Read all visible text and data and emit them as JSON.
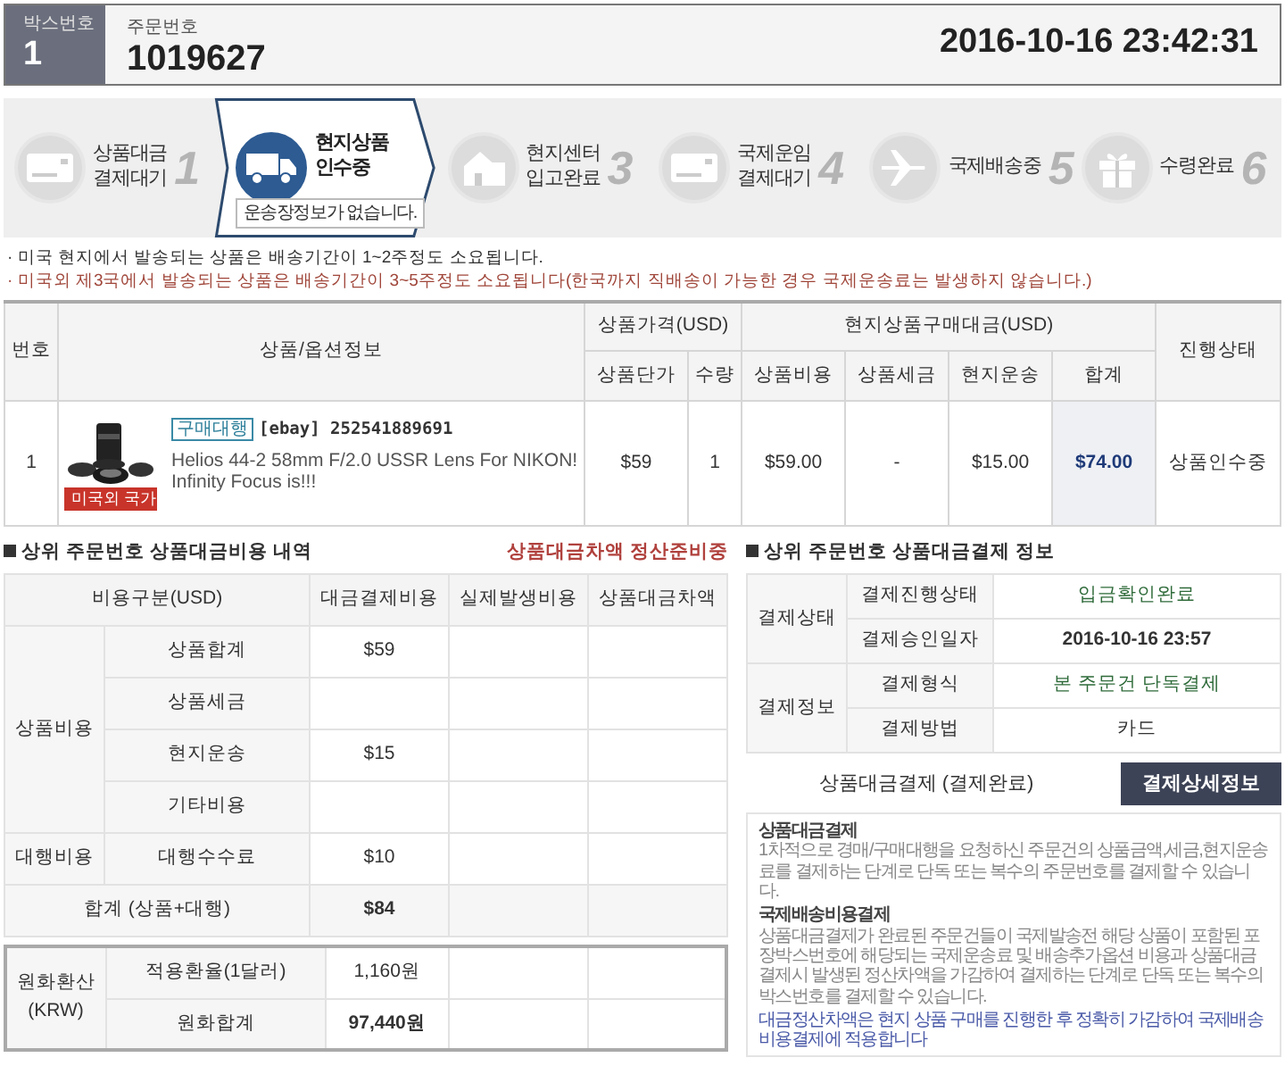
{
  "header": {
    "box_label": "박스번호",
    "box_number": "1",
    "order_label": "주문번호",
    "order_number": "1019627",
    "datetime": "2016-10-16 23:42:31"
  },
  "steps": [
    {
      "number": "1",
      "label": [
        "상품대금",
        "결제대기"
      ],
      "selected": false
    },
    {
      "label": [
        "현지상품",
        "인수중"
      ],
      "selected": true,
      "note": "운송장정보가 없습니다."
    },
    {
      "number": "3",
      "label": [
        "현지센터",
        "입고완료"
      ],
      "selected": false
    },
    {
      "number": "4",
      "label": [
        "국제운임",
        "결제대기"
      ],
      "selected": false
    },
    {
      "number": "5",
      "label": [
        "국제배송중"
      ],
      "selected": false
    },
    {
      "number": "6",
      "label": [
        "수령완료"
      ],
      "selected": false
    }
  ],
  "notices": [
    {
      "text": "· 미국 현지에서 발송되는 상품은 배송기간이 1~2주정도 소요됩니다.",
      "kind": "info"
    },
    {
      "text": "· 미국외 제3국에서 발송되는 상품은 배송기간이 3~5주정도 소요됩니다(한국까지 직배송이 가능한 경우 국제운송료는 발생하지 않습니다.)",
      "kind": "warning"
    }
  ],
  "order_table": {
    "columns": [
      "번호",
      "상품/옵션정보",
      "상품가격(USD)",
      "현지상품구매대금(USD)",
      "진행상태"
    ],
    "subcolumns": [
      "상품단가",
      "수량",
      "상품비용",
      "상품세금",
      "현지운송",
      "합계"
    ],
    "rows": [
      {
        "no": "1",
        "badge": "구매대행",
        "site_and_id": "[ebay] 252541889691",
        "name": "Helios 44-2 58mm F/2.0 USSR Lens For NIKON! Infinity Focus is!!!",
        "origin_tag": "미국외 국가",
        "unit_price": "$59",
        "qty": "1",
        "cost": "$59.00",
        "tax": "-",
        "shipping": "$15.00",
        "total": "$74.00",
        "status": "상품인수중"
      }
    ]
  },
  "cost_table": {
    "title": "상위 주문번호 상품대금비용 내역",
    "status": "상품대금차액 정산준비중",
    "columns": [
      "비용구분(USD)",
      "대금결제비용",
      "실제발생비용",
      "상품대금차액"
    ],
    "groups": [
      {
        "label": "상품비용",
        "rows": [
          {
            "label": "상품합계",
            "payment": "$59"
          },
          {
            "label": "상품세금"
          },
          {
            "label": "현지운송",
            "payment": "$15"
          },
          {
            "label": "기타비용"
          }
        ]
      },
      {
        "label": "대행비용",
        "rows": [
          {
            "label": "대행수수료",
            "payment": "$10"
          }
        ]
      }
    ],
    "total": {
      "label": "합계 (상품+대행)",
      "payment": "$84"
    },
    "krw": {
      "label": [
        "원화환산",
        "(KRW)"
      ],
      "rows": [
        {
          "label": "적용환율(1달러)",
          "payment": "1,160원"
        },
        {
          "label": "원화합계",
          "payment": "97,440원"
        }
      ]
    }
  },
  "payment_info": {
    "title": "상위 주문번호 상품대금결제 정보",
    "groups": [
      {
        "label": "결제상태",
        "rows": [
          {
            "label": "결제진행상태",
            "value": "입금확인완료",
            "kind": "status"
          },
          {
            "label": "결제승인일자",
            "value": "2016-10-16 23:57",
            "kind": "date"
          }
        ]
      },
      {
        "label": "결제정보",
        "rows": [
          {
            "label": "결제형식",
            "value": "본 주문건 단독결제",
            "kind": "status"
          },
          {
            "label": "결제방법",
            "value": "카드",
            "kind": "plain"
          }
        ]
      }
    ]
  },
  "buttons": [
    {
      "label": "상품대금결제 (결제완료)",
      "disabled": true
    },
    {
      "label": "결제상세정보",
      "disabled": false
    }
  ],
  "help": {
    "sections": [
      {
        "title": "상품대금결제",
        "text": "1차적으로 경매/구매대행을 요청하신 주문건의 상품금액,세금,현지운송료를 결제하는 단계로 단독 또는 복수의 주문번호를 결제할 수 있습니다."
      },
      {
        "title": "국제배송비용결제",
        "text": "상품대금결제가 완료된 주문건들이 국제발송전 해당 상품이 포함된 포장박스번호에 해당되는 국제운송료 및 배송추가옵션 비용과 상품대금결제시 발생된 정산차액을 가감하여 결제하는 단계로 단독 또는 복수의 박스번호를 결제할 수 있습니다."
      }
    ],
    "note": "대금정산차액은 현지 상품 구매를 진행한 후 정확히 가감하여 국제배송비용결제에 적용합니다"
  }
}
